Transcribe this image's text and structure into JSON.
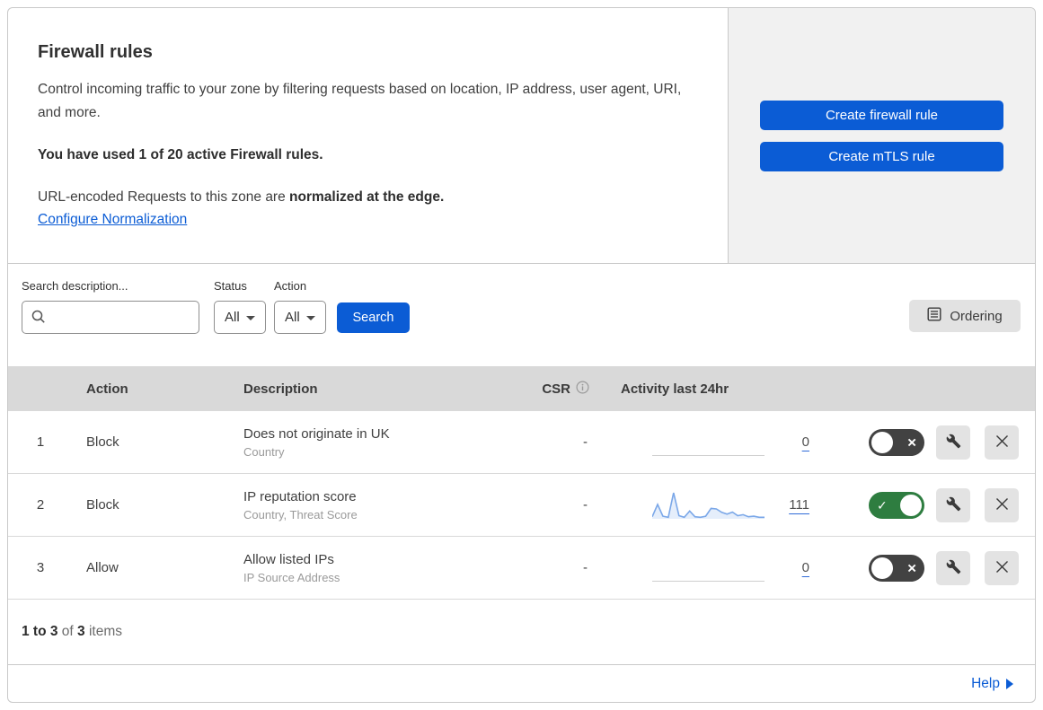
{
  "header": {
    "title": "Firewall rules",
    "description": "Control incoming traffic to your zone by filtering requests based on location, IP address, user agent, URI, and more.",
    "usage_notice": "You have used 1 of 20 active Firewall rules.",
    "normalization_prefix": "URL-encoded Requests to this zone are ",
    "normalization_bold": "normalized at the edge.",
    "normalization_link": "Configure Normalization",
    "create_firewall_button": "Create firewall rule",
    "create_mtls_button": "Create mTLS rule"
  },
  "filters": {
    "search_label": "Search description...",
    "status_label": "Status",
    "status_value": "All",
    "action_label": "Action",
    "action_value": "All",
    "search_button": "Search",
    "ordering_button": "Ordering"
  },
  "table": {
    "columns": {
      "action": "Action",
      "description": "Description",
      "csr": "CSR",
      "activity": "Activity last 24hr"
    },
    "rows": [
      {
        "number": "1",
        "action": "Block",
        "description": "Does not originate in UK",
        "criteria": "Country",
        "csr": "-",
        "activity_count": "0",
        "enabled": false,
        "sparkline": []
      },
      {
        "number": "2",
        "action": "Block",
        "description": "IP reputation score",
        "criteria": "Country, Threat Score",
        "csr": "-",
        "activity_count": "111",
        "enabled": true,
        "sparkline": [
          8,
          55,
          10,
          6,
          100,
          12,
          6,
          30,
          8,
          6,
          10,
          40,
          38,
          25,
          18,
          26,
          12,
          16,
          8,
          10,
          6,
          6
        ]
      },
      {
        "number": "3",
        "action": "Allow",
        "description": "Allow listed IPs",
        "criteria": "IP Source Address",
        "csr": "-",
        "activity_count": "0",
        "enabled": false,
        "sparkline": []
      }
    ]
  },
  "footer": {
    "range_bold": "1 to 3",
    "of_text": " of ",
    "total_bold": "3",
    "items_text": " items",
    "help_link": "Help"
  },
  "colors": {
    "accent_blue": "#0b5cd5",
    "toggle_on_green": "#2e7d40",
    "toggle_off_gray": "#424242",
    "sparkline_blue": "#7aa7e8",
    "panel_gray": "#f1f1f1",
    "table_header_gray": "#d9d9d9"
  }
}
